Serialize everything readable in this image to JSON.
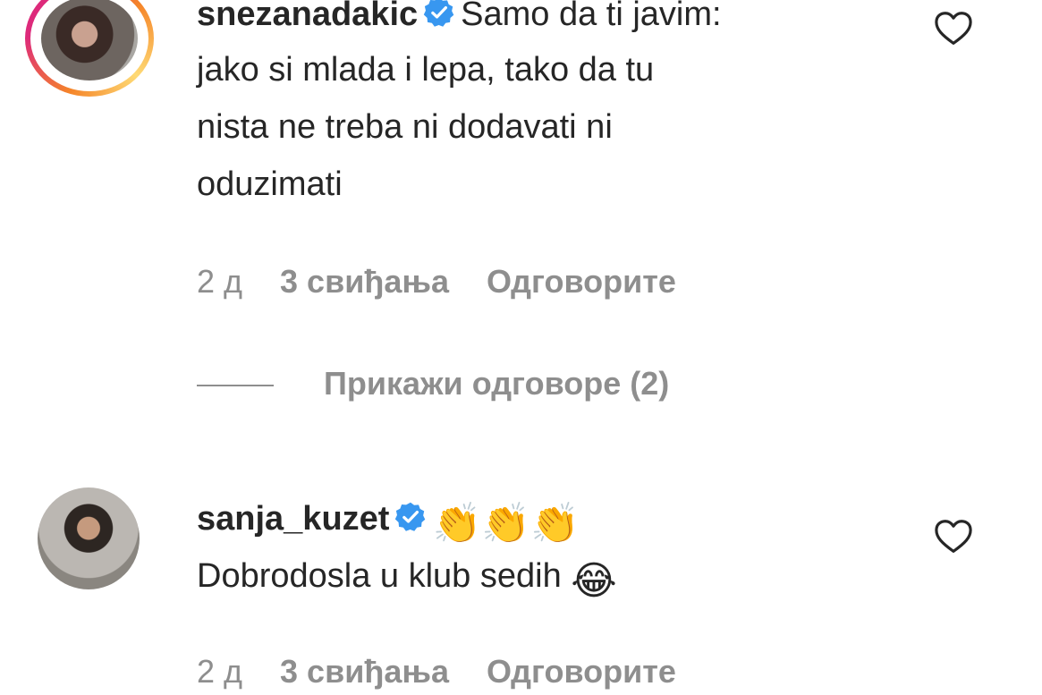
{
  "comments": [
    {
      "username": "snezanadakic",
      "verified": true,
      "text_line1": "Samo da ti javim:",
      "text_line2": "jako si mlada i lepa, tako da tu",
      "text_line3": "nista ne treba ni dodavati ni",
      "text_line4": "oduzimati",
      "time": "2 д",
      "likes": "3 свиђања",
      "reply_label": "Одговорите",
      "view_replies": "Прикажи одговоре (2)"
    },
    {
      "username": "sanja_kuzet",
      "verified": true,
      "emoji_line1": "👏👏👏",
      "text_line2": "Dobrodosla u klub sedih",
      "emoji_line2": "😂",
      "time": "2 д",
      "likes": "3 свиђања",
      "reply_label": "Одговорите"
    }
  ],
  "colors": {
    "verified_blue": "#3897f0",
    "secondary_text": "#8e8e8e",
    "primary_text": "#262626"
  },
  "icons": {
    "like": "heart-outline-icon",
    "verified": "verified-badge-icon"
  }
}
